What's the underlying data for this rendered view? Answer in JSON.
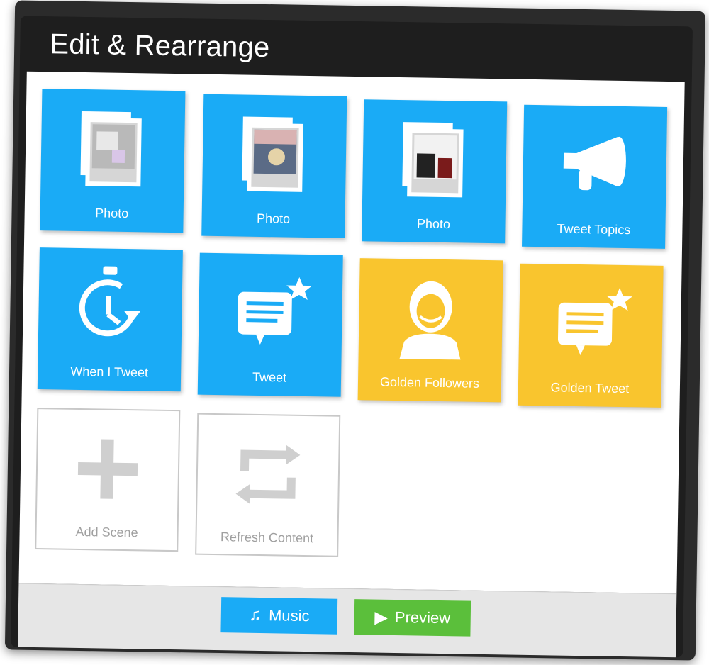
{
  "window": {
    "title": "Edit & Rearrange"
  },
  "tiles": [
    {
      "label": "Photo",
      "icon": "photo-stack-icon",
      "color": "#1aabf6"
    },
    {
      "label": "Photo",
      "icon": "photo-stack-icon",
      "color": "#1aabf6"
    },
    {
      "label": "Photo",
      "icon": "photo-stack-icon",
      "color": "#1aabf6"
    },
    {
      "label": "Tweet Topics",
      "icon": "megaphone-icon",
      "color": "#1aabf6"
    },
    {
      "label": "When I Tweet",
      "icon": "clock-refresh-icon",
      "color": "#1aabf6"
    },
    {
      "label": "Tweet",
      "icon": "speech-bubble-star-icon",
      "color": "#1aabf6"
    },
    {
      "label": "Golden Followers",
      "icon": "follower-avatar-icon",
      "color": "#f9c52e"
    },
    {
      "label": "Golden Tweet",
      "icon": "speech-bubble-star-icon",
      "color": "#f9c52e"
    },
    {
      "label": "Add Scene",
      "icon": "plus-icon",
      "color": "#c8c8c8"
    },
    {
      "label": "Refresh Content",
      "icon": "refresh-arrows-icon",
      "color": "#c8c8c8"
    }
  ],
  "footer": {
    "music_label": "Music",
    "preview_label": "Preview",
    "music_icon": "music-note-icon",
    "preview_icon": "play-icon"
  }
}
